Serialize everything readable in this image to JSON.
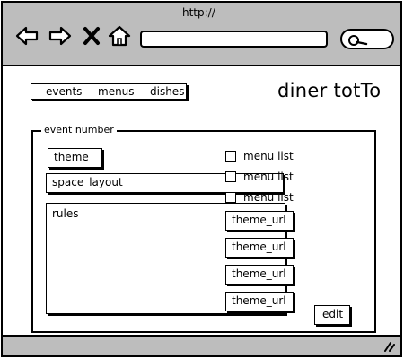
{
  "browser": {
    "url_label": "http://",
    "address_value": "",
    "icons": [
      "back-arrow-icon",
      "forward-arrow-icon",
      "stop-icon",
      "home-icon",
      "search-icon",
      "resize-grip-icon"
    ]
  },
  "nav": {
    "items": [
      {
        "label": "events"
      },
      {
        "label": "menus"
      },
      {
        "label": "dishes"
      }
    ]
  },
  "site": {
    "title": "diner totTo"
  },
  "panel": {
    "legend": "event number",
    "theme_label": "theme",
    "layout_label": "space_layout",
    "rules_label": "rules",
    "checkbox_items": [
      {
        "label": "menu list",
        "checked": false
      },
      {
        "label": "menu list",
        "checked": false
      },
      {
        "label": "menu list",
        "checked": false
      }
    ],
    "url_fields": [
      {
        "label": "theme_url"
      },
      {
        "label": "theme_url"
      },
      {
        "label": "theme_url"
      },
      {
        "label": "theme_url"
      }
    ],
    "edit_label": "edit"
  },
  "colors": {
    "chrome": "#bdbdbd",
    "ink": "#000000",
    "background": "#ffffff"
  }
}
